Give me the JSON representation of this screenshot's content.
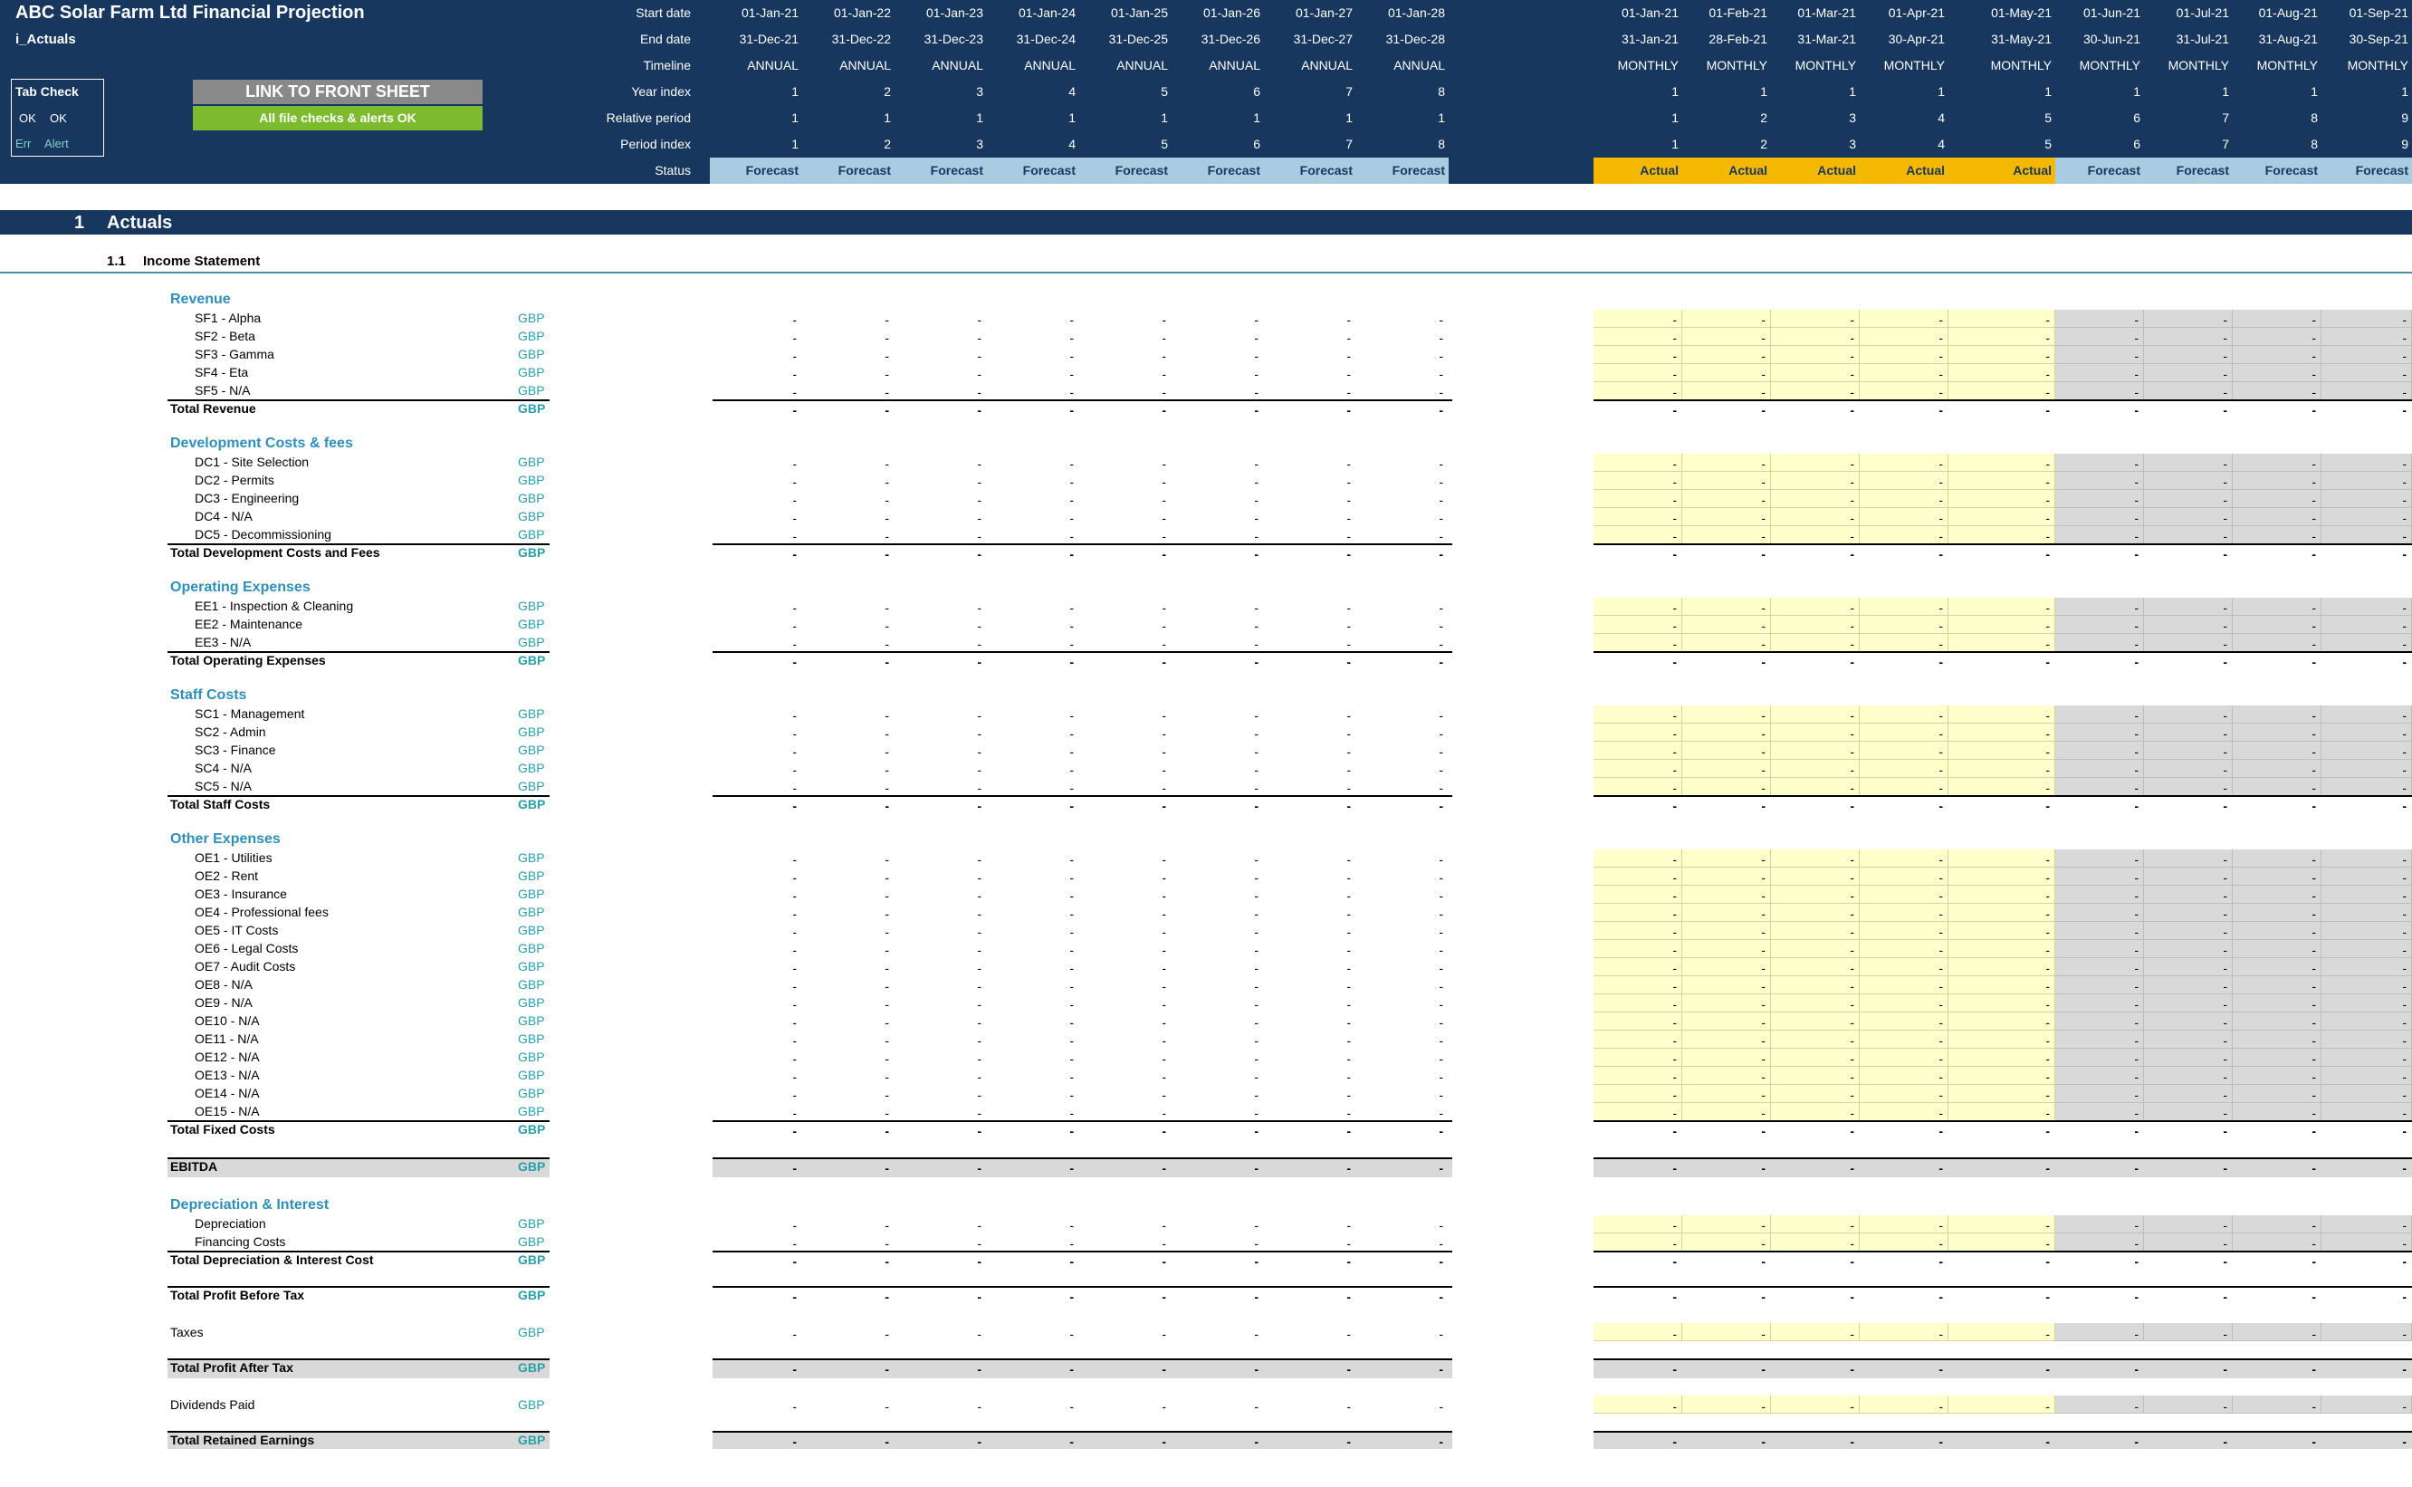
{
  "header": {
    "title": "ABC Solar Farm Ltd Financial Projection",
    "sheet": "i_Actuals",
    "tab_check": {
      "title": "Tab Check",
      "ok1": "OK",
      "ok2": "OK",
      "err": "Err",
      "alert": "Alert"
    },
    "link_button": "LINK TO FRONT SHEET",
    "status_banner": "All file checks & alerts OK",
    "row_labels": [
      "Start date",
      "End date",
      "Timeline",
      "Year index",
      "Relative period",
      "Period index",
      "Status"
    ],
    "annual": {
      "start": [
        "01-Jan-21",
        "01-Jan-22",
        "01-Jan-23",
        "01-Jan-24",
        "01-Jan-25",
        "01-Jan-26",
        "01-Jan-27",
        "01-Jan-28"
      ],
      "end": [
        "31-Dec-21",
        "31-Dec-22",
        "31-Dec-23",
        "31-Dec-24",
        "31-Dec-25",
        "31-Dec-26",
        "31-Dec-27",
        "31-Dec-28"
      ],
      "timeline": [
        "ANNUAL",
        "ANNUAL",
        "ANNUAL",
        "ANNUAL",
        "ANNUAL",
        "ANNUAL",
        "ANNUAL",
        "ANNUAL"
      ],
      "year_index": [
        "1",
        "2",
        "3",
        "4",
        "5",
        "6",
        "7",
        "8"
      ],
      "relative": [
        "1",
        "1",
        "1",
        "1",
        "1",
        "1",
        "1",
        "1"
      ],
      "period": [
        "1",
        "2",
        "3",
        "4",
        "5",
        "6",
        "7",
        "8"
      ],
      "status": [
        "Forecast",
        "Forecast",
        "Forecast",
        "Forecast",
        "Forecast",
        "Forecast",
        "Forecast",
        "Forecast"
      ]
    },
    "monthly": {
      "start": [
        "01-Jan-21",
        "01-Feb-21",
        "01-Mar-21",
        "01-Apr-21",
        "01-May-21",
        "01-Jun-21",
        "01-Jul-21",
        "01-Aug-21",
        "01-Sep-21"
      ],
      "end": [
        "31-Jan-21",
        "28-Feb-21",
        "31-Mar-21",
        "30-Apr-21",
        "31-May-21",
        "30-Jun-21",
        "31-Jul-21",
        "31-Aug-21",
        "30-Sep-21"
      ],
      "timeline": [
        "MONTHLY",
        "MONTHLY",
        "MONTHLY",
        "MONTHLY",
        "MONTHLY",
        "MONTHLY",
        "MONTHLY",
        "MONTHLY",
        "MONTHLY"
      ],
      "year_index": [
        "1",
        "1",
        "1",
        "1",
        "1",
        "1",
        "1",
        "1",
        "1"
      ],
      "relative": [
        "1",
        "2",
        "3",
        "4",
        "5",
        "6",
        "7",
        "8",
        "9"
      ],
      "period": [
        "1",
        "2",
        "3",
        "4",
        "5",
        "6",
        "7",
        "8",
        "9"
      ],
      "status": [
        "Actual",
        "Actual",
        "Actual",
        "Actual",
        "Actual",
        "Forecast",
        "Forecast",
        "Forecast",
        "Forecast"
      ]
    }
  },
  "colors": {
    "header_bg": "#17375e",
    "forecast": "#a9cce3",
    "actual": "#f5b800",
    "input_yellow": "#ffffcc",
    "grey": "#d9d9d9",
    "group_blue": "#2e8fb8",
    "unit_teal": "#2aa0a8"
  },
  "section": {
    "number": "1",
    "title": "Actuals"
  },
  "subsection": {
    "number": "1.1",
    "title": "Income Statement"
  },
  "dash": "-",
  "unit": "GBP",
  "groups": [
    {
      "title": "Revenue",
      "items": [
        "SF1 - Alpha",
        "SF2 - Beta",
        "SF3 - Gamma",
        "SF4 - Eta",
        "SF5 - N/A"
      ],
      "total": "Total Revenue"
    },
    {
      "title": "Development Costs & fees",
      "items": [
        "DC1 - Site Selection",
        "DC2 - Permits",
        "DC3 - Engineering",
        "DC4 - N/A",
        "DC5 - Decommissioning"
      ],
      "total": "Total Development Costs and Fees"
    },
    {
      "title": "Operating Expenses",
      "items": [
        "EE1 - Inspection & Cleaning",
        "EE2 - Maintenance",
        "EE3 - N/A"
      ],
      "total": "Total Operating Expenses"
    },
    {
      "title": "Staff Costs",
      "items": [
        "SC1 - Management",
        "SC2 - Admin",
        "SC3 - Finance",
        "SC4 - N/A",
        "SC5 - N/A"
      ],
      "total": "Total Staff Costs"
    },
    {
      "title": "Other Expenses",
      "items": [
        "OE1 - Utilities",
        "OE2 - Rent",
        "OE3 - Insurance",
        "OE4 - Professional fees",
        "OE5 - IT Costs",
        "OE6 - Legal Costs",
        "OE7 - Audit Costs",
        "OE8 - N/A",
        "OE9 - N/A",
        "OE10 - N/A",
        "OE11 - N/A",
        "OE12 - N/A",
        "OE13 - N/A",
        "OE14 - N/A",
        "OE15 - N/A"
      ],
      "total": "Total Fixed Costs"
    }
  ],
  "ebitda": "EBITDA",
  "dep_group": {
    "title": "Depreciation & Interest",
    "items": [
      "Depreciation",
      "Financing Costs"
    ],
    "total": "Total Depreciation & Interest Cost"
  },
  "pbt": "Total Profit Before Tax",
  "taxes": "Taxes",
  "pat": "Total Profit After Tax",
  "dividends": "Dividends Paid",
  "retained": "Total Retained Earnings"
}
